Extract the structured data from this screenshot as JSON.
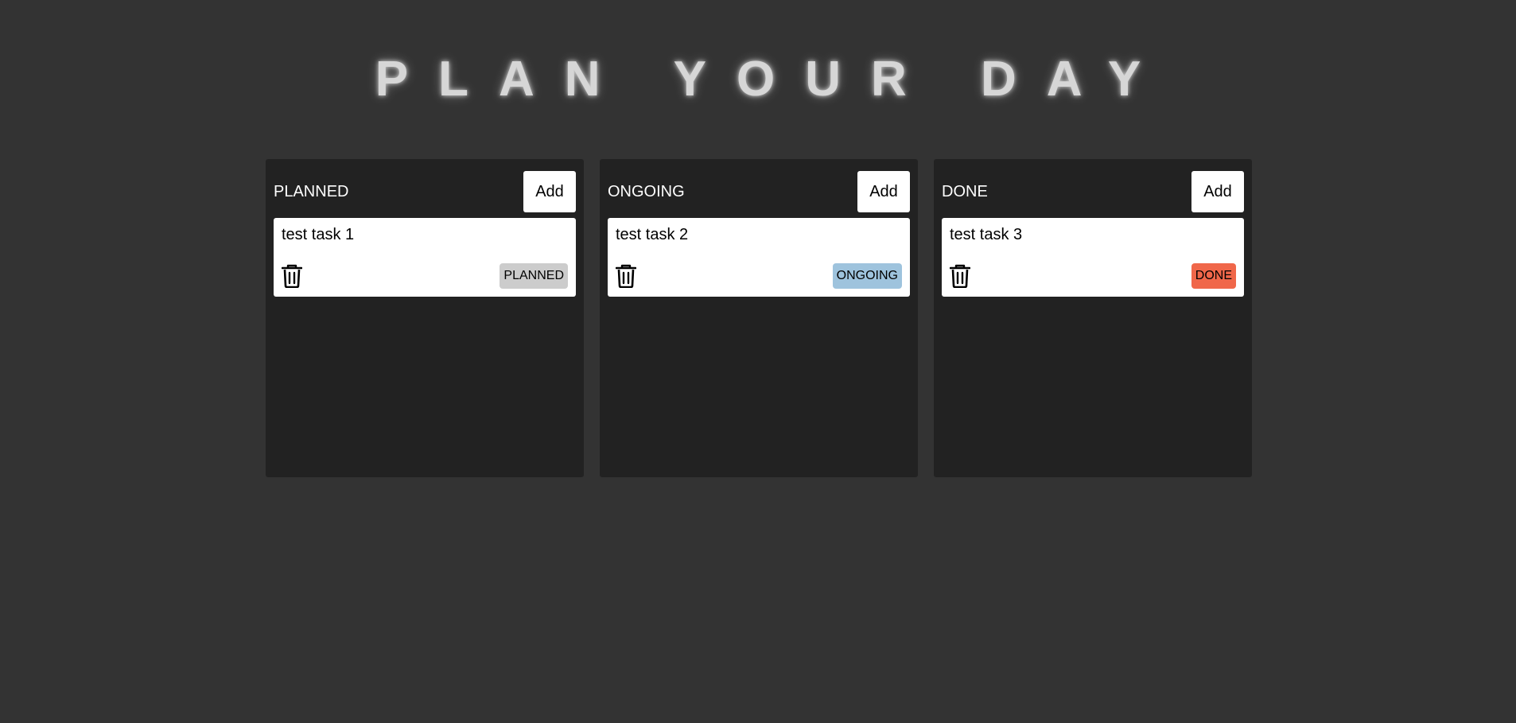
{
  "app": {
    "title": "PLAN YOUR DAY"
  },
  "columns": [
    {
      "title": "PLANNED",
      "add_label": "Add",
      "tasks": [
        {
          "text": "test task 1",
          "status": "PLANNED",
          "status_color": "#cccccc"
        }
      ]
    },
    {
      "title": "ONGOING",
      "add_label": "Add",
      "tasks": [
        {
          "text": "test task 2",
          "status": "ONGOING",
          "status_color": "#9ec3dd"
        }
      ]
    },
    {
      "title": "DONE",
      "add_label": "Add",
      "tasks": [
        {
          "text": "test task 3",
          "status": "DONE",
          "status_color": "#f0674a"
        }
      ]
    }
  ],
  "icons": {
    "delete": "trash-icon"
  },
  "colors": {
    "page_background": "#333333",
    "column_background": "#222222"
  }
}
